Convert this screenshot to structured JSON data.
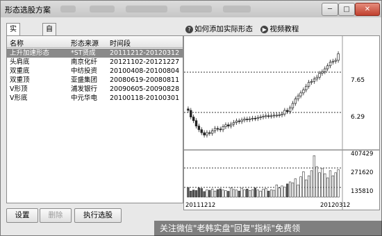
{
  "window": {
    "title": "形态选股方案",
    "controls": {
      "minimize": "─",
      "maximize": "□",
      "close": "✕"
    }
  },
  "tabs": [
    {
      "label": "实际形态",
      "active": true
    },
    {
      "label": "自绘形态",
      "active": false
    }
  ],
  "links": {
    "add_pattern": "如何添加实际形态",
    "video": "视频教程"
  },
  "table": {
    "headers": [
      "名称",
      "形态来源",
      "时间段"
    ],
    "rows": [
      {
        "name": "上升加速形态",
        "source": "*ST贤成",
        "period": "20111212-20120312",
        "selected": true
      },
      {
        "name": "头肩底",
        "source": "南京化纤",
        "period": "20121102-20121227",
        "selected": false
      },
      {
        "name": "双重底",
        "source": "中纺投资",
        "period": "20100408-20100804",
        "selected": false
      },
      {
        "name": "双重顶",
        "source": "亚盛集团",
        "period": "20080619-20080811",
        "selected": false
      },
      {
        "name": "V形顶",
        "source": "浦发银行",
        "period": "20090605-20090828",
        "selected": false
      },
      {
        "name": "V形底",
        "source": "中元华电",
        "period": "20100118-20100301",
        "selected": false
      }
    ]
  },
  "buttons": {
    "settings": "设置",
    "delete": "删除",
    "run": "执行选股"
  },
  "chart_data": {
    "type": "candlestick",
    "price_levels": [
      "7.65",
      "6.29"
    ],
    "volume_levels": [
      "407429",
      "271620",
      "135810"
    ],
    "x_start_label": "20111212",
    "x_end_label": "20120312",
    "closes": [
      6.62,
      6.4,
      6.28,
      6.1,
      5.98,
      5.88,
      5.8,
      5.88,
      5.86,
      5.94,
      6.02,
      6.0,
      5.98,
      6.08,
      6.14,
      6.1,
      6.16,
      6.22,
      6.27,
      6.25,
      6.3,
      6.33,
      6.31,
      6.34,
      6.36,
      6.35,
      6.38,
      6.4,
      6.42,
      6.44,
      6.43,
      6.44,
      6.46,
      6.46,
      6.47,
      6.5,
      6.62,
      6.58,
      6.7,
      6.85,
      7.0,
      7.1,
      7.2,
      7.3,
      7.42,
      7.55,
      7.58,
      7.66,
      7.72,
      7.85,
      7.9,
      8.0,
      8.1,
      8.22,
      8.25,
      8.28,
      8.5
    ],
    "volumes": [
      95000,
      60000,
      70000,
      65000,
      90000,
      85000,
      55000,
      72000,
      68000,
      80000,
      60000,
      75000,
      82000,
      70000,
      64000,
      58000,
      90000,
      76000,
      70000,
      60000,
      88000,
      72000,
      80000,
      66000,
      74000,
      90000,
      70000,
      60000,
      78000,
      84000,
      60000,
      72000,
      68000,
      120000,
      90000,
      110000,
      100000,
      130000,
      150000,
      140000,
      180000,
      120000,
      200000,
      250000,
      170000,
      210000,
      260000,
      407429,
      300000,
      240000,
      280000,
      230000,
      190000,
      260000,
      210000,
      240000,
      270000
    ],
    "ylim_price": [
      5.4,
      8.9
    ],
    "ylim_volume": [
      0,
      450000
    ]
  },
  "watermark": "关注微信\"老韩实盘\"回复\"指标\"免费领"
}
